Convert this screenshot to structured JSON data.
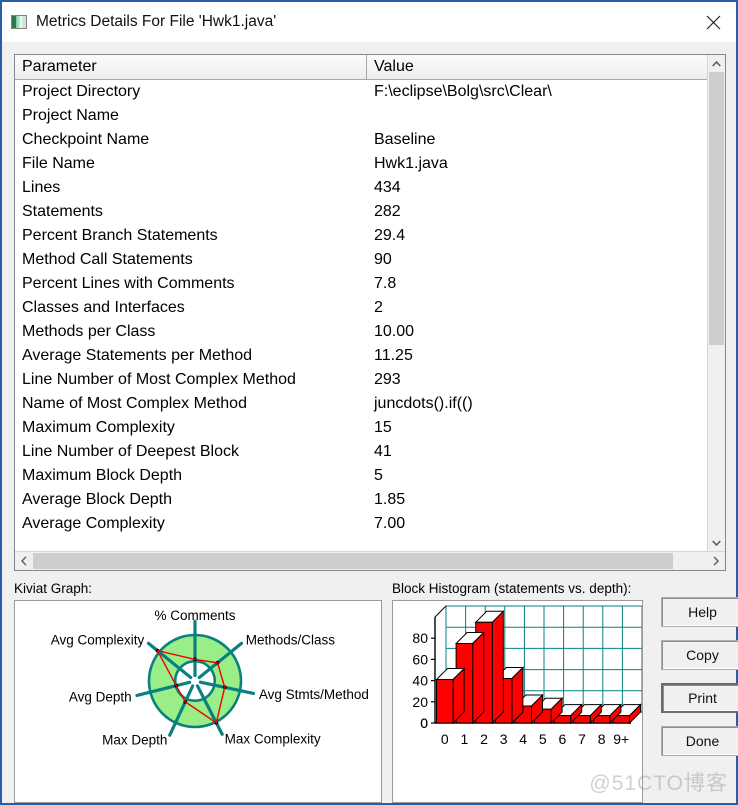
{
  "window": {
    "title": "Metrics Details For File 'Hwk1.java'",
    "app_icon": "metrics-icon",
    "close_label": "✕",
    "border_color": "#2a5da8"
  },
  "table": {
    "headers": [
      "Parameter",
      "Value"
    ],
    "rows": [
      [
        "Project Directory",
        "F:\\eclipse\\Bolg\\src\\Clear\\"
      ],
      [
        "Project Name",
        ""
      ],
      [
        "Checkpoint Name",
        "Baseline"
      ],
      [
        "File Name",
        "Hwk1.java"
      ],
      [
        "Lines",
        "434"
      ],
      [
        "Statements",
        "282"
      ],
      [
        "Percent Branch Statements",
        "29.4"
      ],
      [
        "Method Call Statements",
        "90"
      ],
      [
        "Percent Lines with Comments",
        "7.8"
      ],
      [
        "Classes and Interfaces",
        "2"
      ],
      [
        "Methods per Class",
        "10.00"
      ],
      [
        "Average Statements per Method",
        "11.25"
      ],
      [
        "Line Number of Most Complex Method",
        "293"
      ],
      [
        "Name of Most Complex Method",
        "juncdots().if(()"
      ],
      [
        "Maximum Complexity",
        "15"
      ],
      [
        "Line Number of Deepest Block",
        "41"
      ],
      [
        "Maximum Block Depth",
        "5"
      ],
      [
        "Average Block Depth",
        "1.85"
      ],
      [
        "Average Complexity",
        "7.00"
      ]
    ],
    "vscroll": {
      "up": "⌃",
      "down": "⌄",
      "thumb_percent": 59
    },
    "hscroll": {
      "left": "‹",
      "right": "›",
      "thumb_percent": 95
    }
  },
  "kiviat": {
    "label": "Kiviat Graph:",
    "axis_color": "#0a8080",
    "band_color": "#99ee88",
    "data_color": "#ee0000",
    "axes": [
      {
        "label": "% Comments",
        "angle": -90,
        "value": 0.47
      },
      {
        "label": "Methods/Class",
        "angle": -39,
        "value": 0.63
      },
      {
        "label": "Avg Stmts/Method",
        "angle": 12,
        "value": 0.66
      },
      {
        "label": "Max Complexity",
        "angle": 63,
        "value": 1.02
      },
      {
        "label": "Max Depth",
        "angle": 115,
        "value": 0.5
      },
      {
        "label": "Avg Depth",
        "angle": 166,
        "value": 0.42
      },
      {
        "label": "Avg Complexity",
        "angle": 219,
        "value": 1.05
      }
    ]
  },
  "histogram": {
    "label": "Block Histogram (statements vs. depth):",
    "bar_color": "#ff0000",
    "grid_color": "#0a8080"
  },
  "chart_data": {
    "type": "bar",
    "title": "Block Histogram (statements vs. depth)",
    "xlabel": "depth",
    "ylabel": "statements",
    "categories": [
      "0",
      "1",
      "2",
      "3",
      "4",
      "5",
      "6",
      "7",
      "8",
      "9+"
    ],
    "values": [
      41,
      75,
      95,
      42,
      16,
      13,
      0,
      0,
      0,
      0
    ],
    "ytick_labels": [
      "0",
      "20",
      "40",
      "60",
      "80"
    ],
    "ylim": [
      0,
      100
    ],
    "grid": true,
    "legend": "none"
  },
  "buttons": [
    {
      "label": "Help",
      "focused": false
    },
    {
      "label": "Copy",
      "focused": false
    },
    {
      "label": "Print",
      "focused": true
    },
    {
      "label": "Done",
      "focused": false
    }
  ],
  "watermark": "@51CTO博客"
}
